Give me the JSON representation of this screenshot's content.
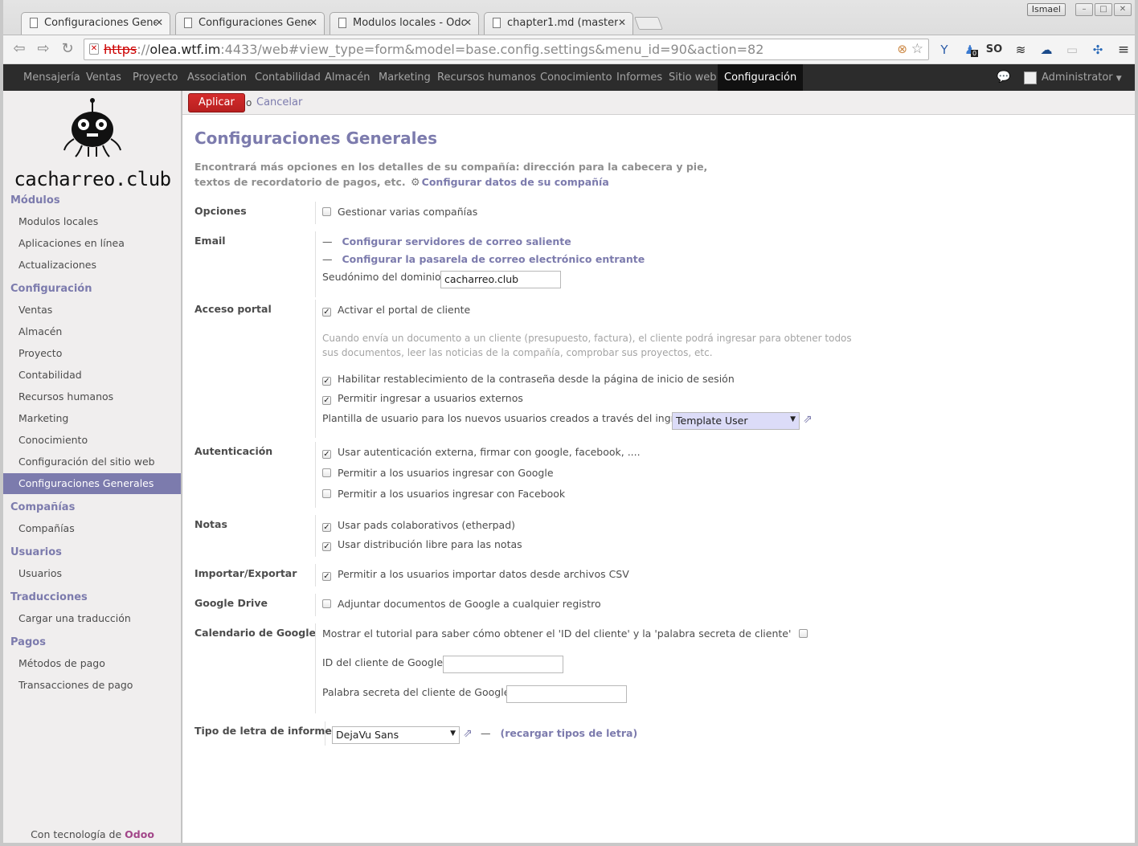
{
  "browser": {
    "tabs": [
      {
        "label": "Configuraciones Gene",
        "active": true
      },
      {
        "label": "Configuraciones Gene",
        "active": false
      },
      {
        "label": "Modulos locales - Odo",
        "active": false
      },
      {
        "label": "chapter1.md (master",
        "active": false
      }
    ],
    "profile_name": "Ismael",
    "url": {
      "scheme": "https",
      "sep": "://",
      "host": "olea.wtf.im",
      "rest": ":4433/web#view_type=form&model=base.config.settings&menu_id=90&action=82"
    },
    "ext_so_label": "SO",
    "ext_badge": "0"
  },
  "topnav": {
    "items": [
      "Mensajería",
      "Ventas",
      "Proyecto",
      "Association",
      "Contabilidad",
      "Almacén",
      "Marketing",
      "Recursos humanos",
      "Conocimiento",
      "Informes",
      "Sitio web",
      "Configuración"
    ],
    "active_index": 11,
    "user": "Administrator"
  },
  "sidebar": {
    "logo_text": "cacharreo.club",
    "sections": [
      {
        "title": "Módulos",
        "items": [
          "Modulos locales",
          "Aplicaciones en línea",
          "Actualizaciones"
        ]
      },
      {
        "title": "Configuración",
        "items": [
          "Ventas",
          "Almacén",
          "Proyecto",
          "Contabilidad",
          "Recursos humanos",
          "Marketing",
          "Conocimiento",
          "Configuración del sitio web",
          "Configuraciones Generales"
        ]
      },
      {
        "title": "Compañías",
        "items": [
          "Compañías"
        ]
      },
      {
        "title": "Usuarios",
        "items": [
          "Usuarios"
        ]
      },
      {
        "title": "Traducciones",
        "items": [
          "Cargar una traducción"
        ]
      },
      {
        "title": "Pagos",
        "items": [
          "Métodos de pago",
          "Transacciones de pago"
        ]
      }
    ],
    "active_item": "Configuraciones Generales",
    "powered_prefix": "Con tecnología de ",
    "powered_brand": "Odoo"
  },
  "buttons": {
    "apply": "Aplicar",
    "or": "o",
    "cancel": "Cancelar"
  },
  "form": {
    "title": "Configuraciones Generales",
    "desc": "Encontrará más opciones en los detalles de su compañía: dirección para la cabecera y pie, textos de recordatorio de pagos, etc.",
    "desc_link": "Configurar datos de su compañía",
    "opciones": {
      "label": "Opciones",
      "multi_company": {
        "text": "Gestionar varias compañías",
        "checked": false
      }
    },
    "email": {
      "label": "Email",
      "link_out": "Configurar servidores de correo saliente",
      "link_in": "Configurar la pasarela de correo electrónico entrante",
      "alias_label": "Seudónimo del dominio",
      "alias_value": "cacharreo.club"
    },
    "portal": {
      "label": "Acceso portal",
      "portal_enable": {
        "text": "Activar el portal de cliente",
        "checked": true
      },
      "help": "Cuando envía un documento a un cliente (presupuesto, factura), el cliente podrá ingresar para obtener todos sus documentos, leer las noticias de la compañía, comprobar sus proyectos, etc.",
      "reset_pwd": {
        "text": "Habilitar restablecimiento de la contraseña desde la página de inicio de sesión",
        "checked": true
      },
      "ext_users": {
        "text": "Permitir ingresar a usuarios externos",
        "checked": true
      },
      "template_label": "Plantilla de usuario para los nuevos usuarios creados a través del ingreso",
      "template_value": "Template User"
    },
    "auth": {
      "label": "Autenticación",
      "oauth": {
        "text": "Usar autenticación externa, firmar con google, facebook, ....",
        "checked": true
      },
      "google": {
        "text": "Permitir a los usuarios ingresar con Google",
        "checked": false
      },
      "facebook": {
        "text": "Permitir a los usuarios ingresar con Facebook",
        "checked": false
      }
    },
    "notes": {
      "label": "Notas",
      "pad": {
        "text": "Usar pads colaborativos (etherpad)",
        "checked": true
      },
      "free": {
        "text": "Usar distribución libre para las notas",
        "checked": true
      }
    },
    "import": {
      "label": "Importar/Exportar",
      "csv": {
        "text": "Permitir a los usuarios importar datos desde archivos CSV",
        "checked": true
      }
    },
    "gdrive": {
      "label": "Google Drive",
      "attach": {
        "text": "Adjuntar documentos de Google a cualquier registro",
        "checked": false
      }
    },
    "gcal": {
      "label": "Calendario de Google",
      "tutorial": {
        "text": "Mostrar el tutorial para saber cómo obtener el 'ID del cliente' y la 'palabra secreta de cliente'",
        "checked": false
      },
      "client_id_label": "ID del cliente de Google",
      "client_id_value": "",
      "secret_label": "Palabra secreta del cliente de Google",
      "secret_value": ""
    },
    "font": {
      "label": "Tipo de letra de informe",
      "value": "DejaVu Sans",
      "reload": "(recargar tipos de letra)"
    }
  }
}
